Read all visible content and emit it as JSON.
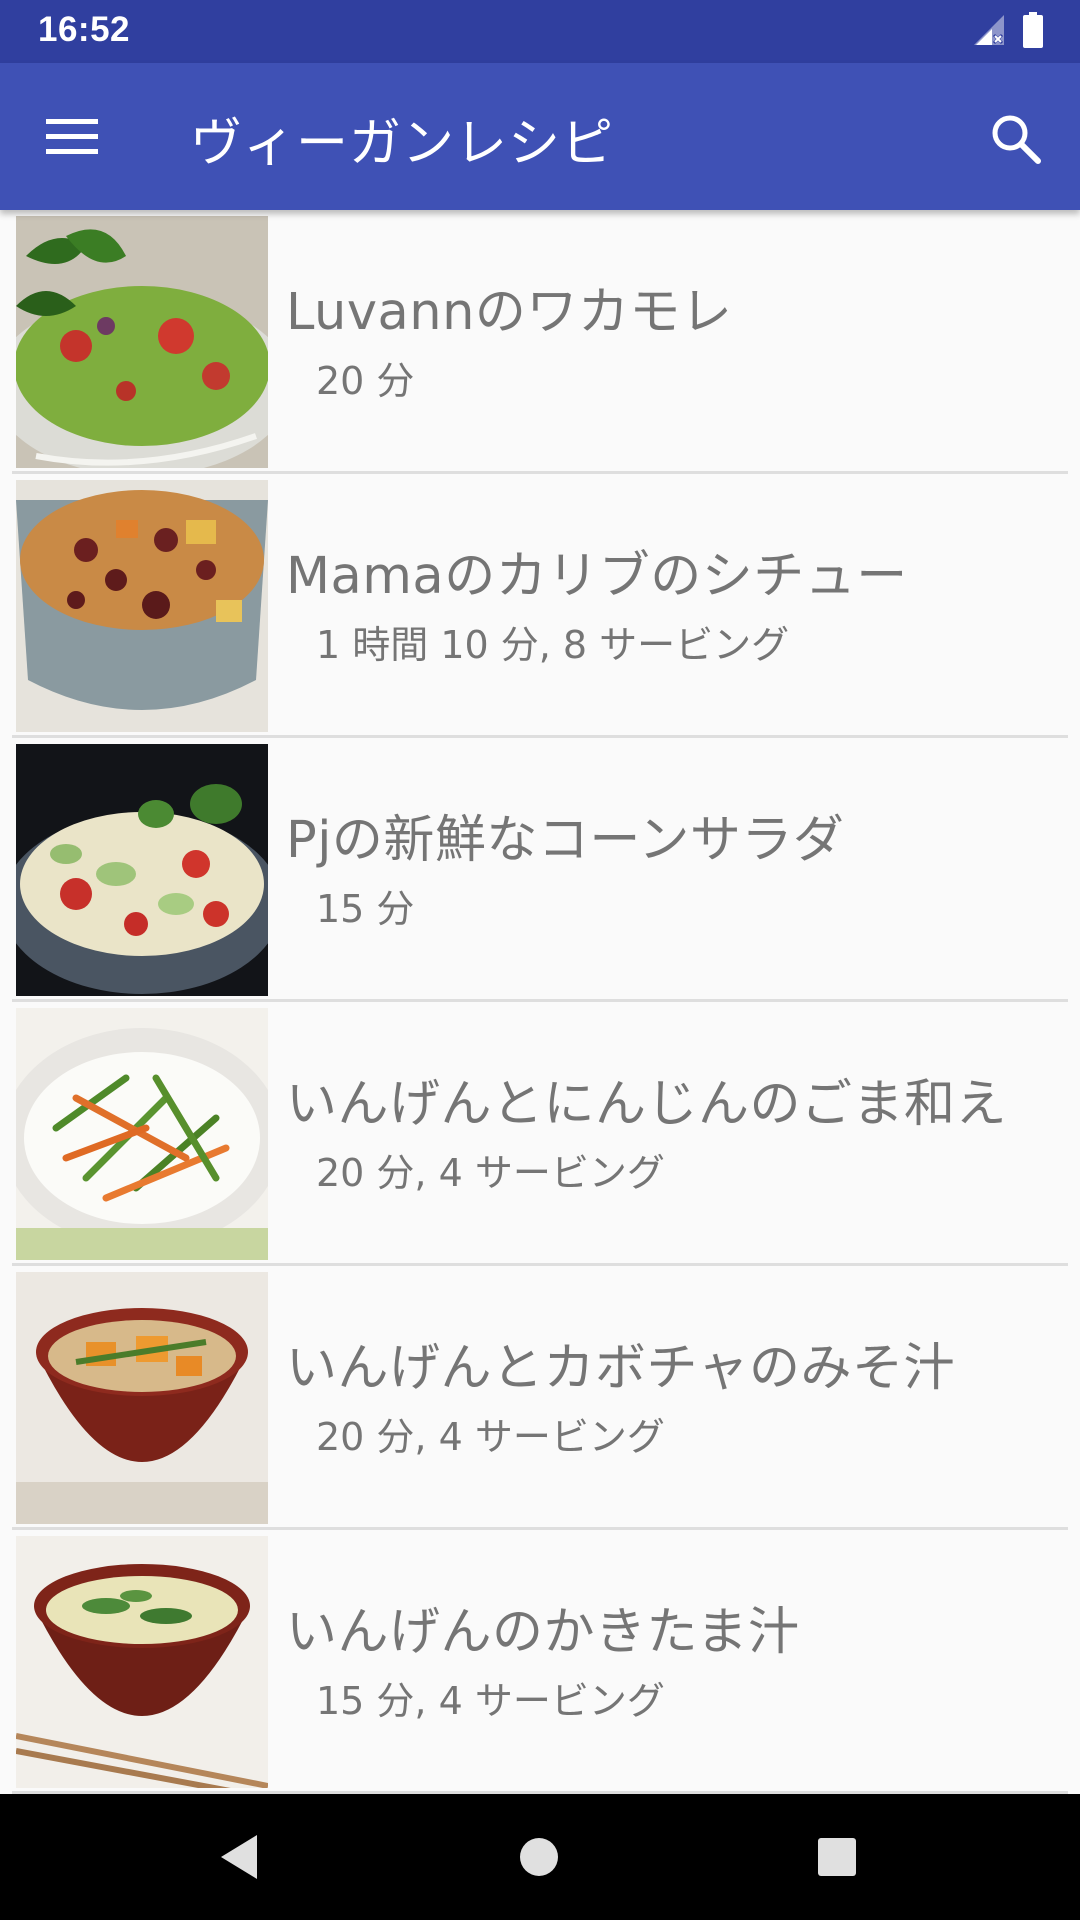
{
  "status_bar": {
    "time": "16:52",
    "icons": [
      "signal-icon",
      "battery-icon"
    ]
  },
  "app_bar": {
    "title": "ヴィーガンレシピ",
    "menu_icon": "hamburger-menu-icon",
    "search_icon": "search-icon",
    "color": "#3f51b5",
    "status_color": "#303f9f"
  },
  "recipes": [
    {
      "title": "Luvannのワカモレ",
      "meta": "20 分",
      "thumb": "guacamole-photo"
    },
    {
      "title": "Mamaのカリブのシチュー",
      "meta": "1 時間 10 分, 8 サービング",
      "thumb": "caribbean-stew-photo"
    },
    {
      "title": "Pjの新鮮なコーンサラダ",
      "meta": "15 分",
      "thumb": "corn-salad-photo"
    },
    {
      "title": "いんげんとにんじんのごま和え",
      "meta": "20 分, 4 サービング",
      "thumb": "green-beans-carrot-sesame-photo"
    },
    {
      "title": "いんげんとカボチャのみそ汁",
      "meta": "20 分, 4 サービング",
      "thumb": "bean-pumpkin-miso-soup-photo"
    },
    {
      "title": "いんげんのかきたま汁",
      "meta": "15 分, 4 サービング",
      "thumb": "bean-egg-drop-soup-photo"
    }
  ],
  "nav_bar": {
    "back_icon": "back-triangle-icon",
    "home_icon": "home-circle-icon",
    "recents_icon": "recents-square-icon"
  }
}
